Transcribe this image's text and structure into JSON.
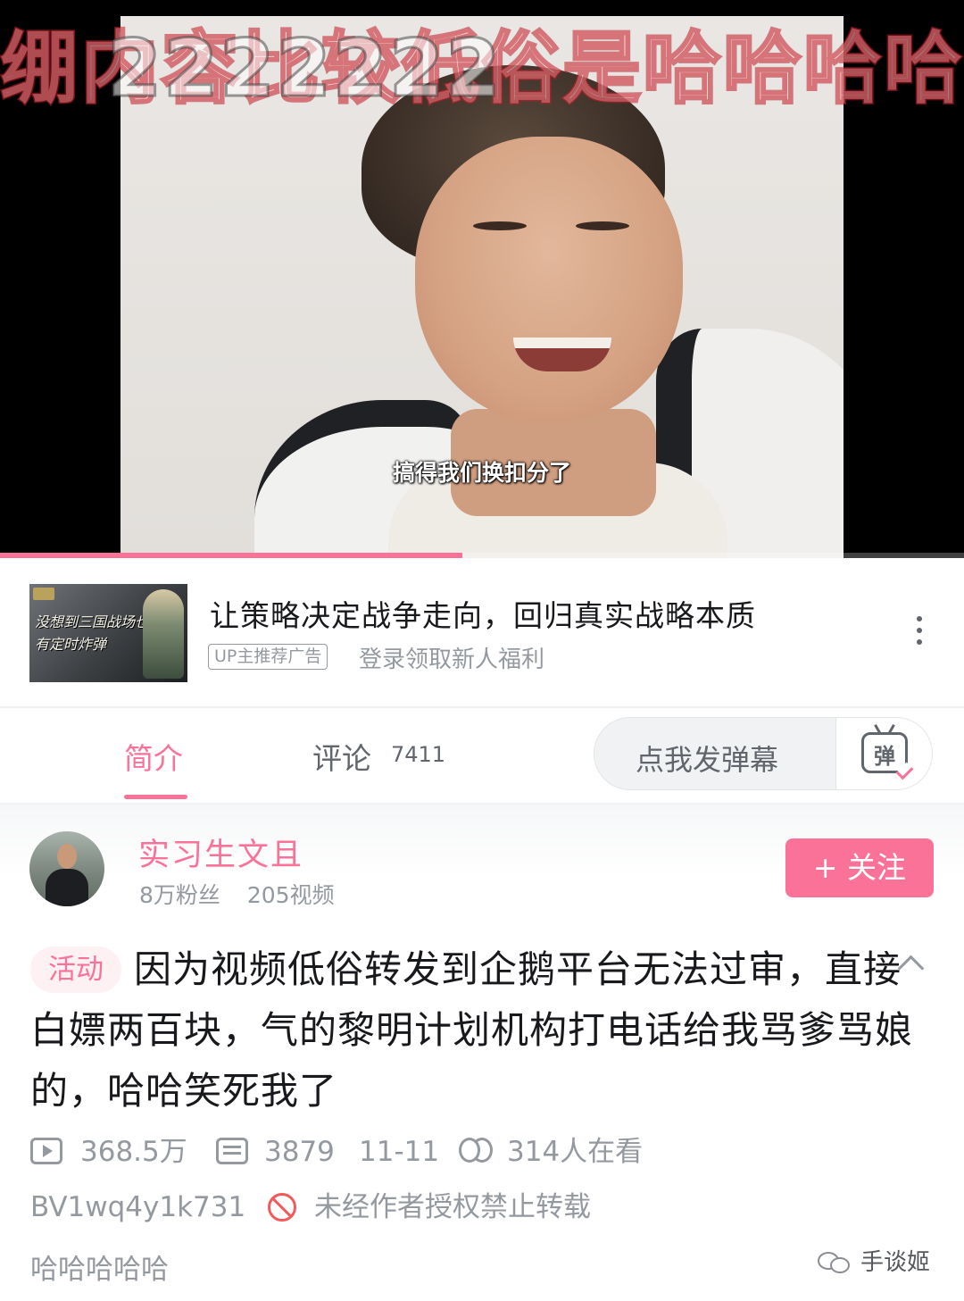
{
  "player": {
    "danmaku_line1": "绷内容比较低俗是哈哈哈哈哈哈",
    "danmaku_line2": "2222222",
    "subtitle": "搞得我们换扣分了",
    "progress": 0.48
  },
  "ad": {
    "thumbnail_text": "没想到三国战场也有定时炸弹",
    "title": "让策略决定战争走向，回归真实战略本质",
    "tag": "UP主推荐广告",
    "subtitle": "登录领取新人福利"
  },
  "tabs": {
    "intro": "简介",
    "comments": "评论",
    "comments_count": "7411",
    "danmaku_placeholder": "点我发弹幕",
    "danmaku_button_char": "弹"
  },
  "author": {
    "name": "实习生文且",
    "fans": "8万粉丝",
    "videos": "205视频",
    "follow_label": "+ 关注"
  },
  "description": {
    "tag": "活动",
    "text": "因为视频低俗转发到企鹅平台无法过审，直接白嫖两百块，气的黎明计划机构打电话给我骂爹骂娘的，哈哈笑死我了"
  },
  "stats": {
    "plays": "368.5万",
    "danmaku": "3879",
    "date": "11-11",
    "watching": "314人在看",
    "bvid": "BV1wq4y1k731",
    "copyright": "未经作者授权禁止转载",
    "tagline": "哈哈哈哈哈"
  },
  "watermark": {
    "text": "手谈姬"
  },
  "colors": {
    "accent": "#fb7299",
    "text": "#18191c",
    "secondary": "#9499a0",
    "warning": "#f45a5a"
  }
}
